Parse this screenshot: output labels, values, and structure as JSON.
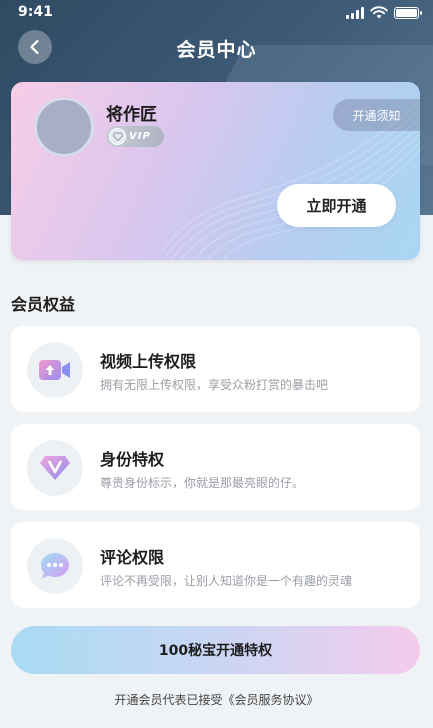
{
  "status_bar": {
    "time": "9:41"
  },
  "header": {
    "title": "会员中心"
  },
  "member_card": {
    "username": "将作匠",
    "vip_label": "VIP",
    "notice_label": "开通须知",
    "open_button": "立即开通"
  },
  "benefits": {
    "section_title": "会员权益",
    "items": [
      {
        "title": "视频上传权限",
        "desc": "拥有无限上传权限，享受众粉打赏的暴击吧"
      },
      {
        "title": "身份特权",
        "desc": "尊贵身份标示，你就是那最亮眼的仔。"
      },
      {
        "title": "评论权限",
        "desc": "评论不再受限，让别人知道你是一个有趣的灵魂"
      }
    ]
  },
  "cta": {
    "label": "100秘宝开通特权"
  },
  "agreement": {
    "prefix": "开通会员代表已接受",
    "link": "《会员服务协议》"
  },
  "colors": {
    "header_bg": "#3e5b78",
    "card_gradient_start": "#f7cde6",
    "card_gradient_end": "#a9d7f4",
    "cta_gradient_start": "#a9dbf3",
    "cta_gradient_end": "#f4cbec"
  }
}
